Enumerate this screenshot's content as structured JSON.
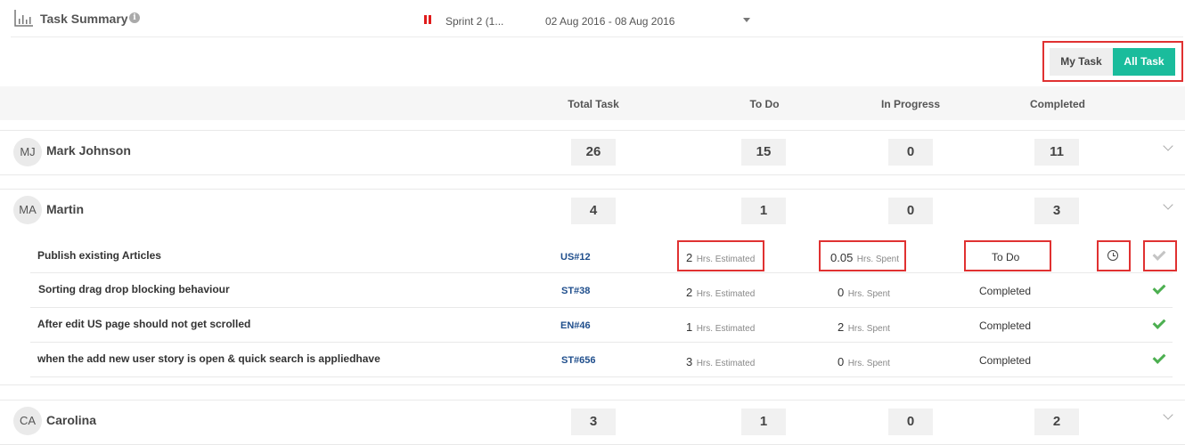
{
  "header": {
    "title": "Task Summary",
    "sprint_name": "Sprint 2 (1...",
    "sprint_dates": "02 Aug 2016 - 08 Aug 2016"
  },
  "toggle": {
    "my_task": "My Task",
    "all_task": "All Task"
  },
  "columns": {
    "total": "Total Task",
    "todo": "To Do",
    "in_progress": "In Progress",
    "completed": "Completed"
  },
  "members": [
    {
      "initials": "MJ",
      "name": "Mark Johnson",
      "total": "26",
      "todo": "15",
      "in_progress": "0",
      "completed": "11"
    },
    {
      "initials": "MA",
      "name": "Martin",
      "total": "4",
      "todo": "1",
      "in_progress": "0",
      "completed": "3"
    },
    {
      "initials": "CA",
      "name": "Carolina",
      "total": "3",
      "todo": "1",
      "in_progress": "0",
      "completed": "2"
    }
  ],
  "units": {
    "estimated": "Hrs. Estimated",
    "spent": "Hrs. Spent"
  },
  "tasks": [
    {
      "title": "Publish existing Articles",
      "id": "US#12",
      "estimated": "2",
      "spent": "0.05",
      "status": "To Do",
      "completed": false
    },
    {
      "title": "Sorting drag drop blocking behaviour",
      "id": "ST#38",
      "estimated": "2",
      "spent": "0",
      "status": "Completed",
      "completed": true
    },
    {
      "title": "After edit US page should not get scrolled",
      "id": "EN#46",
      "estimated": "1",
      "spent": "2",
      "status": "Completed",
      "completed": true
    },
    {
      "title": "when the add new user story is open & quick search is appliedhave",
      "id": "ST#656",
      "estimated": "3",
      "spent": "0",
      "status": "Completed",
      "completed": true
    }
  ],
  "colors": {
    "accent": "#1abc9c",
    "highlight": "#e03131",
    "check": "#4caf50",
    "link": "#1f4e8c"
  }
}
